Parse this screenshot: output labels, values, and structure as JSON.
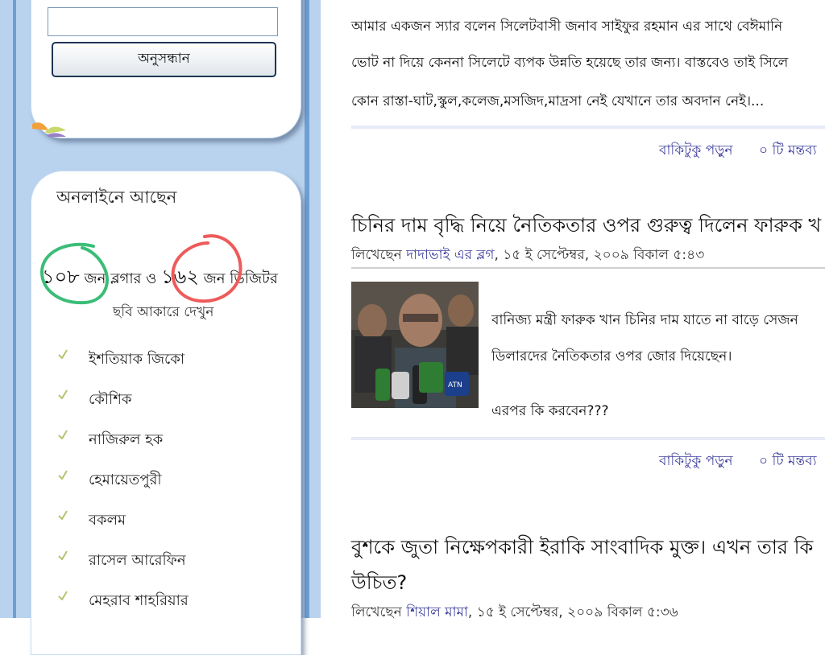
{
  "sidebar": {
    "search_button_label": "অনুসন্ধান",
    "online_heading": "অনলাইনে আছেন",
    "online": {
      "bloggers_count": "১০৮",
      "bloggers_text": "জন ব্লগার ও",
      "visitors_count": "১৬২",
      "visitors_text": "জন ভিজিটর"
    },
    "view_as_image": "ছবি আকারে দেখুন",
    "users": [
      "ইশতিয়াক জিকো",
      "কৌশিক",
      "নাজিরুল হক",
      "হেমায়েতপুরী",
      "বকলম",
      "রাসেল আরেফিন",
      "মেহরাব শাহরিয়ার"
    ]
  },
  "post1": {
    "lines": [
      "আমার একজন স্যার বলেন সিলেটবাসী জনাব সাইফুর রহমান এর সাথে বেঈমানি",
      "ভোট না দিয়ে কেননা সিলেটে ব্যপক উন্নতি হয়েছে তার জন্য। বাস্তবেও তাই সিলে",
      "কোন রাস্তা-ঘাট,স্কুল,কলেজ,মসজিদ,মাদ্রসা নেই যেখানে তার অবদান নেই।..."
    ],
    "read_more": "বাকিটুকু পড়ুন",
    "comments": "০ টি মন্তব্য"
  },
  "post2": {
    "title": "চিনির দাম বৃদ্ধি নিয়ে নৈতিকতার ওপর গুরুত্ব দিলেন ফারুক খ",
    "byline_prefix": "লিখেছেন",
    "author": "দাদাভাই এর ব্লগ",
    "date": ", ১৫ ই সেপ্টেম্বর, ২০০৯ বিকাল ৫:৪৩",
    "lines": [
      "বানিজ্য মন্ত্রী ফারুক খান চিনির দাম যাতে না বাড়ে সেজন",
      "ডিলারদের নৈতিকতার ওপর জোর দিয়েছেন।",
      "এরপর কি করবেন???"
    ],
    "read_more": "বাকিটুকু পড়ুন",
    "comments": "০ টি মন্তব্য",
    "mic_label": "ATN"
  },
  "post3": {
    "title_line1": "বুশকে জুতা নিক্ষেপকারী ইরাকি সাংবাদিক মুক্ত। এখন তার কি",
    "title_line2": "উচিত?",
    "byline_prefix": "লিখেছেন",
    "author": "শিয়াল মামা",
    "date": ", ১৫ ই সেপ্টেম্বর, ২০০৯ বিকাল ৫:৩৬"
  },
  "colors": {
    "sidebar_bg": "#b9d3ee",
    "link": "#3f3f9f",
    "green_circle": "#3bbd78",
    "red_circle": "#ef5a5a"
  }
}
